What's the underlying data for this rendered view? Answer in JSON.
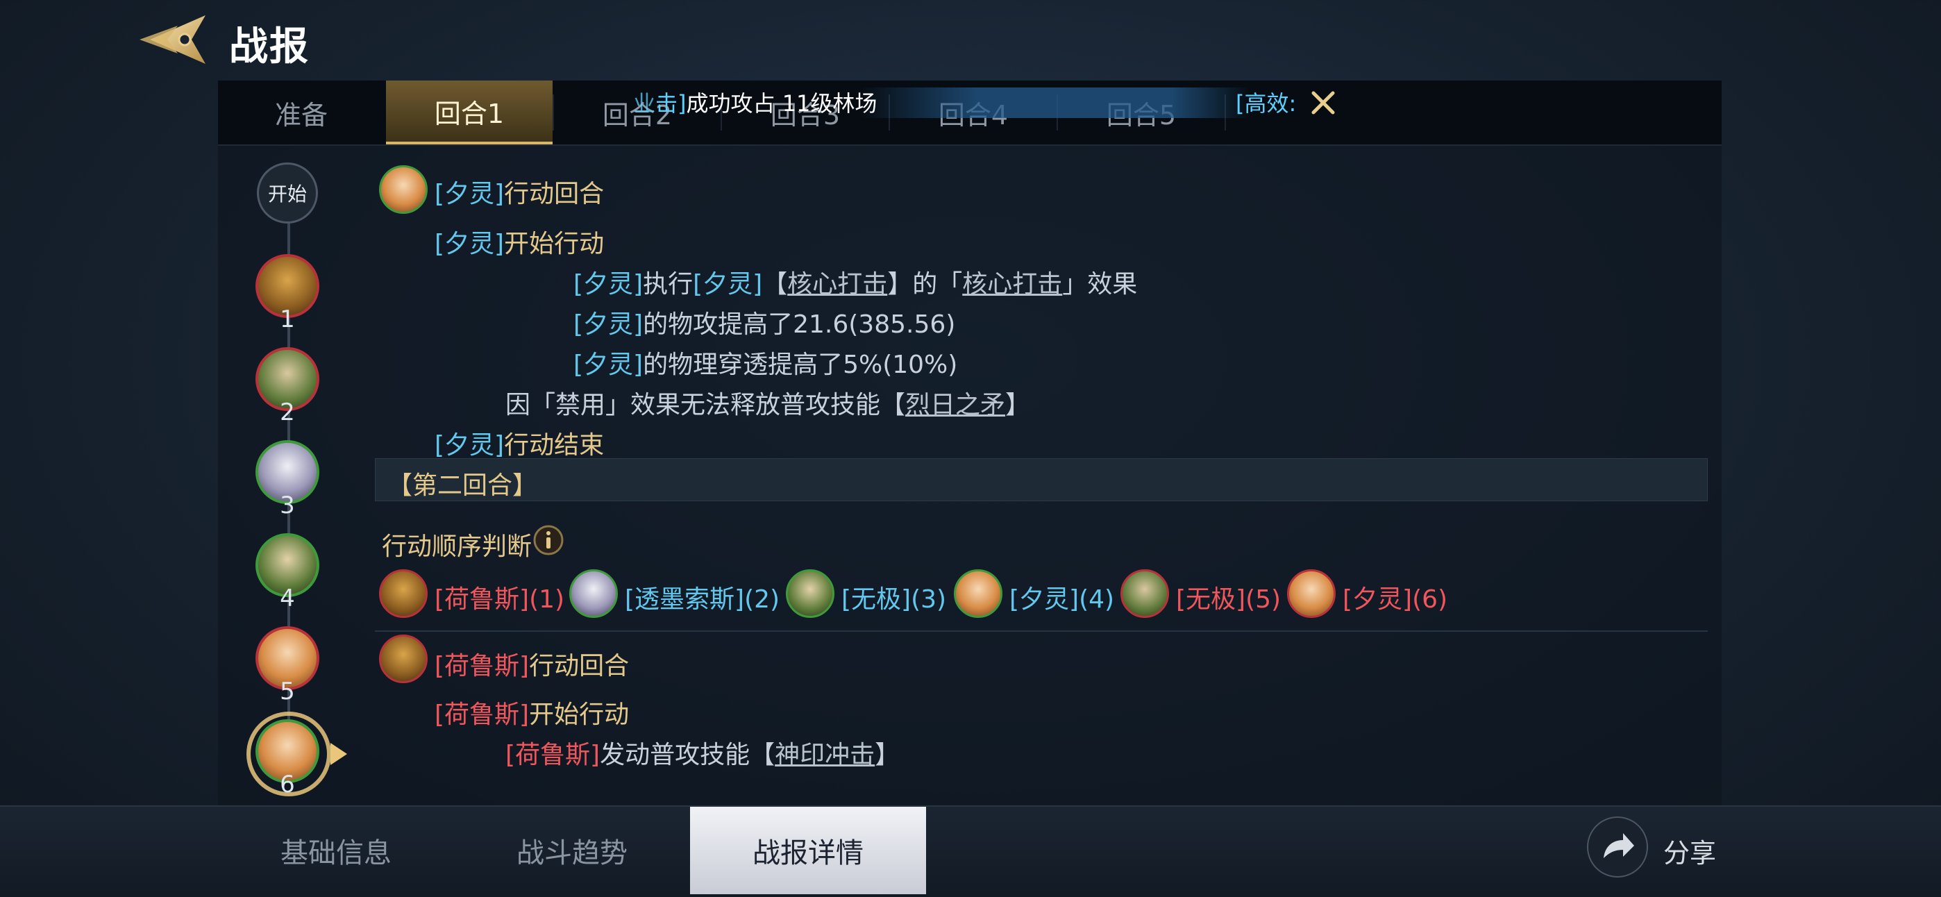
{
  "header": {
    "title": "战报"
  },
  "round_tabs": [
    {
      "label": "准备"
    },
    {
      "label": "回合1"
    },
    {
      "label": "回合2"
    },
    {
      "label": "回合3"
    },
    {
      "label": "回合4"
    },
    {
      "label": "回合5"
    }
  ],
  "notification": {
    "prefix": "击]",
    "prefix_cut": "业",
    "text": "成功攻占 11级林场",
    "efficient": "[高效:"
  },
  "timeline": {
    "start": "开始",
    "nodes": [
      "1",
      "2",
      "3",
      "4",
      "5",
      "6"
    ]
  },
  "log": {
    "l1": {
      "name": "[夕灵]",
      "text": "行动回合"
    },
    "l2": {
      "name": "[夕灵]",
      "text": "开始行动"
    },
    "l3": {
      "a": "[夕灵]",
      "b": "执行",
      "c": "[夕灵]",
      "d": "【",
      "e": "核心打击",
      "f": "】的「",
      "g": "核心打击",
      "h": "」效果"
    },
    "l4": {
      "name": "[夕灵]",
      "text": "的物攻提高了21.6(385.56)"
    },
    "l5": {
      "name": "[夕灵]",
      "text": "的物理穿透提高了5%(10%)"
    },
    "l6": {
      "a": "因「禁用」效果无法释放普攻技能【",
      "b": "烈日之矛",
      "c": "】"
    },
    "l7": {
      "name": "[夕灵]",
      "text": "行动结束"
    },
    "round2": "【第二回合】",
    "order_title": "行动顺序判断",
    "order": [
      {
        "name": "[荷鲁斯]",
        "num": "(1)"
      },
      {
        "name": "[透墨索斯]",
        "num": "(2)"
      },
      {
        "name": "[无极]",
        "num": "(3)"
      },
      {
        "name": "[夕灵]",
        "num": "(4)"
      },
      {
        "name": "[无极]",
        "num": "(5)"
      },
      {
        "name": "[夕灵]",
        "num": "(6)"
      }
    ],
    "l8": {
      "name": "[荷鲁斯]",
      "text": "行动回合"
    },
    "l9": {
      "name": "[荷鲁斯]",
      "text": "开始行动"
    },
    "l10": {
      "name": "[荷鲁斯]",
      "a": "发动普攻技能【",
      "b": "神印冲击",
      "c": "】"
    }
  },
  "bottom_tabs": [
    {
      "label": "基础信息"
    },
    {
      "label": "战斗趋势"
    },
    {
      "label": "战报详情"
    }
  ],
  "share": {
    "label": "分享"
  },
  "colors": {
    "blue_name": "#63c8ee",
    "red_name": "#f0565c",
    "gold": "#e4c98b",
    "active_tab": "#d9b66b"
  }
}
